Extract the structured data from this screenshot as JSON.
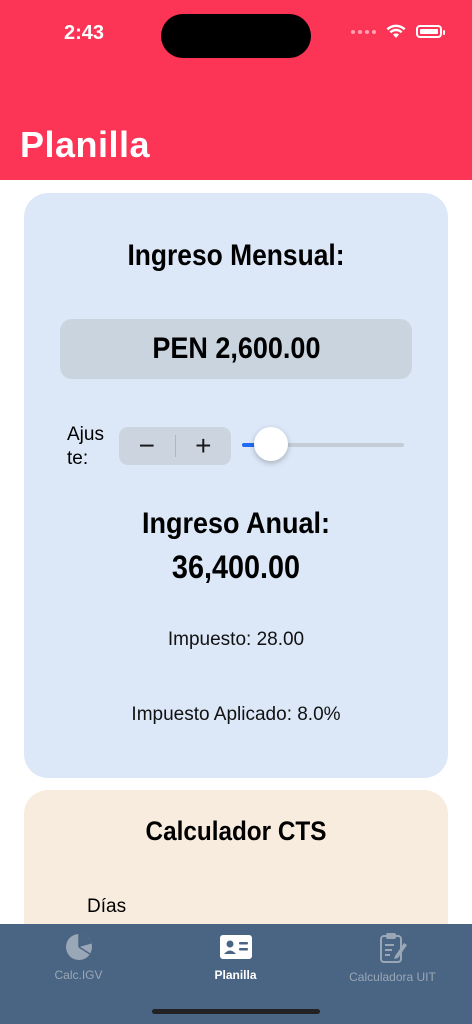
{
  "status_bar": {
    "time": "2:43"
  },
  "nav": {
    "title": "Planilla"
  },
  "income_card": {
    "title": "Ingreso Mensual:",
    "amount": "PEN 2,600.00",
    "adjust_label": "Ajus te:",
    "stepper": {
      "minus": "−",
      "plus": "+"
    },
    "slider_fraction": 0.18,
    "annual_label": "Ingreso Anual:",
    "annual_value": "36,400.00",
    "tax_line": "Impuesto: 28.00",
    "applied_tax_line": "Impuesto Aplicado: 8.0%"
  },
  "cts_card": {
    "title": "Calculador CTS",
    "days_label": "Días"
  },
  "tabs": [
    {
      "label": "Calc.IGV",
      "icon": "pie-chart-icon",
      "active": false
    },
    {
      "label": "Planilla",
      "icon": "person-card-icon",
      "active": true
    },
    {
      "label": "Calculadora UIT",
      "icon": "clipboard-edit-icon",
      "active": false
    }
  ],
  "colors": {
    "header": "#fc3456",
    "income_card": "#dce8f8",
    "cts_card": "#f7ecdd",
    "tabbar": "#4a6583",
    "slider_accent": "#1f6bf2"
  }
}
